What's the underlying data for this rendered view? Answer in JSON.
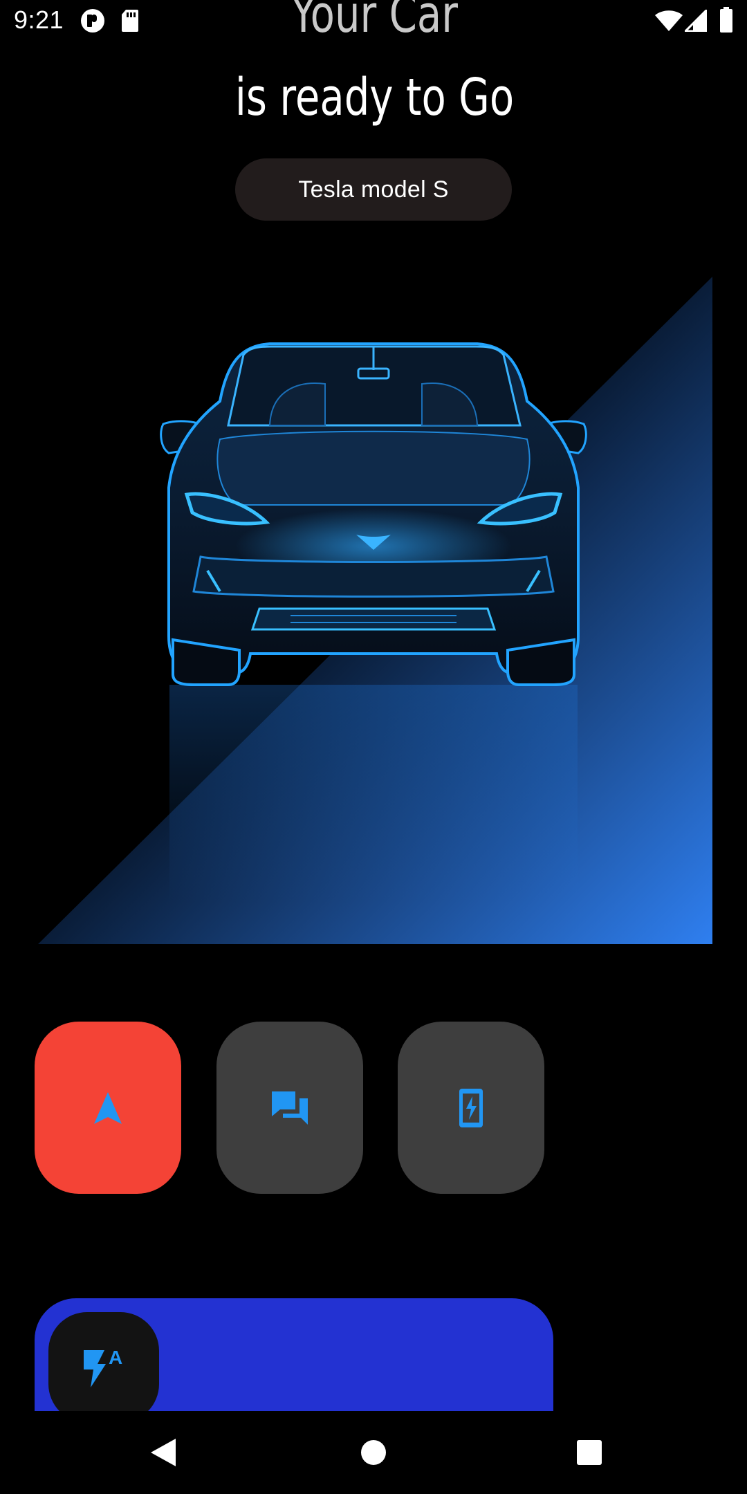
{
  "status_bar": {
    "time": "9:21",
    "left_icons": [
      "app-notification-icon",
      "sd-card-icon"
    ],
    "right_icons": [
      "wifi-icon",
      "cellular-signal-icon",
      "battery-icon"
    ]
  },
  "header": {
    "line1": "Your Car",
    "line2": "is ready to Go"
  },
  "model_chip": {
    "label": "Tesla model S"
  },
  "hero": {
    "image": "electric-car-front-view",
    "glow_color": "#2f7ff0",
    "wire_color": "#22a4ff"
  },
  "actions": [
    {
      "icon": "navigation-arrow-icon",
      "bg": "#f44336"
    },
    {
      "icon": "chat-bubbles-icon",
      "bg": "#3e3e3e"
    },
    {
      "icon": "phone-charging-icon",
      "bg": "#3e3e3e"
    }
  ],
  "slide_bar": {
    "knob_icon": "auto-flash-icon",
    "knob_glyph": "A",
    "bg": "#2332d2"
  },
  "nav_bar": {
    "buttons": [
      "back-icon",
      "home-icon",
      "recents-icon"
    ]
  },
  "colors": {
    "accent_blue": "#2196f3",
    "accent_red": "#f44336"
  }
}
